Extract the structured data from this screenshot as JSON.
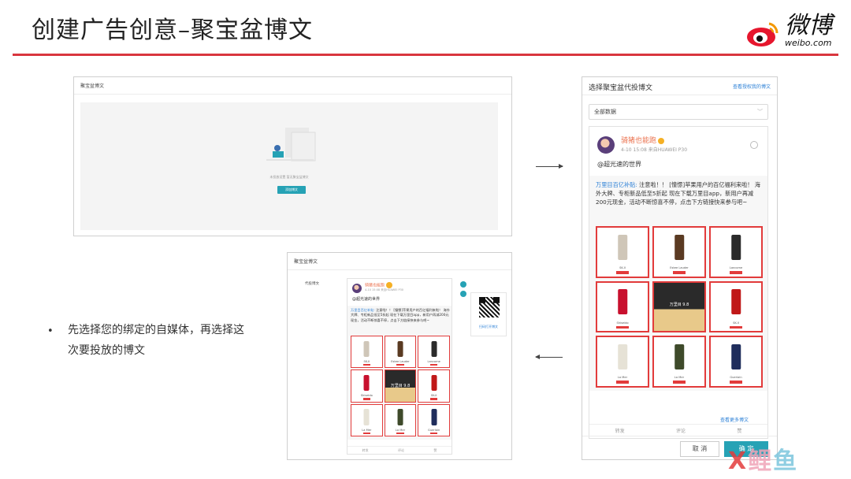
{
  "slide": {
    "title": "创建广告创意–聚宝盆博文",
    "logo_text": "微博",
    "logo_sub": "weibo.com",
    "bullet_text": "先选择您的绑定的自媒体，再选择这次要投放的博文",
    "watermark": [
      "X",
      "鲤",
      "鱼"
    ]
  },
  "shot1": {
    "header": "聚宝盆博文",
    "empty_hint": "未投放设置   暂无聚宝盆博文",
    "add_button": "添加博文"
  },
  "modal": {
    "title": "选择聚宝盆代投博文",
    "auth_link": "查看授权我的博文",
    "filter_value": "全部数据",
    "filter_caret": "﹀",
    "post": {
      "user": "骑猪也能跑",
      "meta": "4-10 15:08  来自HUAWEI P30",
      "mention": "@超光速的世界",
      "text_highlight": "万里目百亿补贴:",
      "text_body": " 注意啦！！ [憧憬]苹果用户的百亿福利来啦！ 海外大牌、专柜新品低至5折起 现在下载万里目app，新用户再减200元现金，活动不断惊喜不停，点击下方链接快来参与吧~",
      "products": [
        {
          "name": "SK-II"
        },
        {
          "name": "Estee Lauder"
        },
        {
          "name": "Lancome"
        },
        {
          "name": "Shiseido"
        },
        {
          "name": "万里目 9.8"
        },
        {
          "name": "SK-II"
        },
        {
          "name": "La Mer"
        },
        {
          "name": "La Mer"
        },
        {
          "name": "Guerlain"
        }
      ],
      "actions": [
        "转发",
        "评论",
        "赞"
      ]
    },
    "more_link": "查看更多博文",
    "cancel": "取 消",
    "ok": "确 定"
  },
  "shot3": {
    "header": "聚宝盆博文",
    "field_label": "代投博文",
    "qr_caption": "扫码打开博文"
  }
}
